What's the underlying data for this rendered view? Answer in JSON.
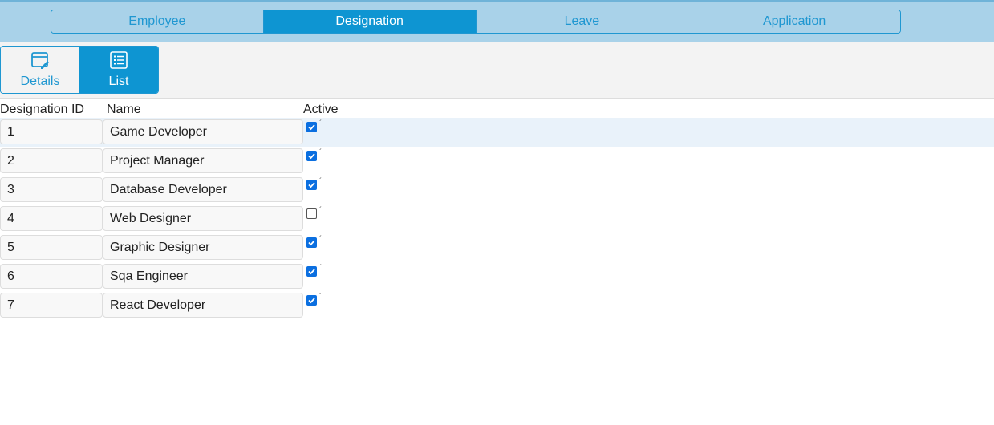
{
  "nav": {
    "tabs": [
      {
        "label": "Employee",
        "active": false
      },
      {
        "label": "Designation",
        "active": true
      },
      {
        "label": "Leave",
        "active": false
      },
      {
        "label": "Application",
        "active": false
      }
    ]
  },
  "toolbar": {
    "details_label": "Details",
    "list_label": "List",
    "active_mode": "List"
  },
  "table": {
    "columns": [
      "Designation ID",
      "Name",
      "Active"
    ],
    "rows": [
      {
        "id": "1",
        "name": "Game Developer",
        "active": true
      },
      {
        "id": "2",
        "name": "Project Manager",
        "active": true
      },
      {
        "id": "3",
        "name": "Database Developer",
        "active": true
      },
      {
        "id": "4",
        "name": "Web Designer",
        "active": false
      },
      {
        "id": "5",
        "name": "Graphic Designer",
        "active": true
      },
      {
        "id": "6",
        "name": "Sqa Engineer",
        "active": true
      },
      {
        "id": "7",
        "name": "React Developer",
        "active": true
      }
    ],
    "highlighted_row": 0,
    "row_suffix_mark": "´"
  },
  "colors": {
    "accent": "#0e95d2",
    "nav_background": "#a9d2e9",
    "checkbox": "#0b6fe0",
    "row_highlight": "#e9f2fa"
  },
  "icons": {
    "details": "window-edit-icon",
    "list": "list-icon"
  }
}
